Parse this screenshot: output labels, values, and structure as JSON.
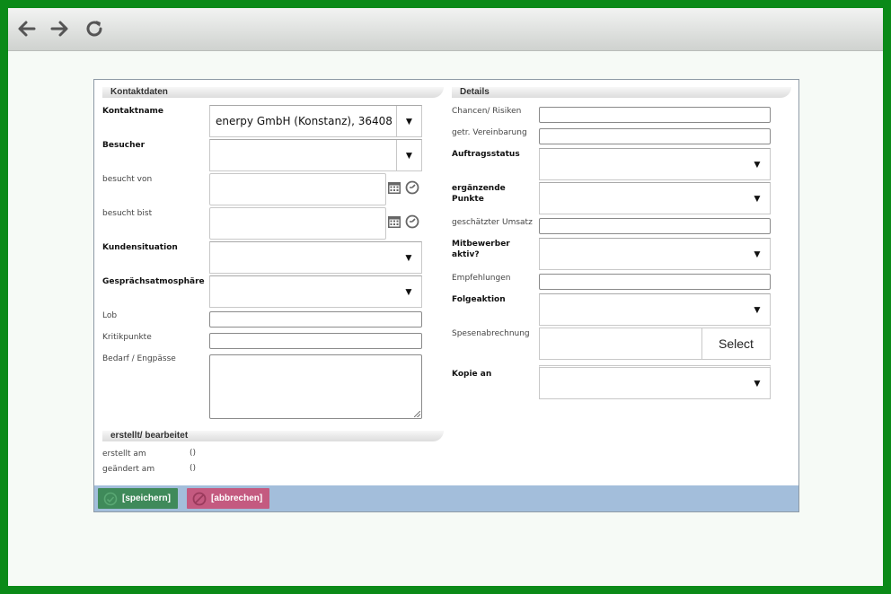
{
  "toolbar": {
    "back_icon": "arrow-left-icon",
    "forward_icon": "arrow-right-icon",
    "reload_icon": "reload-icon"
  },
  "contact": {
    "heading": "Kontaktdaten",
    "kontaktname_label": "Kontaktname",
    "kontaktname_value": "enerpy GmbH (Konstanz), 36408",
    "besucher_label": "Besucher",
    "besucht_von_label": "besucht von",
    "besucht_bist_label": "besucht bist",
    "kundensituation_label": "Kundensituation",
    "gespraech_label": "Gesprächsatmosphäre",
    "lob_label": "Lob",
    "kritik_label": "Kritikpunkte",
    "bedarf_label": "Bedarf / Engpässe"
  },
  "details": {
    "heading": "Details",
    "chancen_label": "Chancen/ Risiken",
    "vereinbarung_label": "getr. Vereinbarung",
    "auftragsstatus_label": "Auftragsstatus",
    "ergaenzende_label": "ergänzende Punkte",
    "umsatz_label": "geschätzter Umsatz",
    "mitbewerber_label": "Mitbewerber aktiv?",
    "empfehlungen_label": "Empfehlungen",
    "folgeaktion_label": "Folgeaktion",
    "spesen_label": "Spesenabrechnung",
    "spesen_button": "Select",
    "kopie_label": "Kopie an"
  },
  "meta": {
    "heading": "erstellt/ bearbeitet",
    "erstellt_label": "erstellt am",
    "erstellt_value": "()",
    "geaendert_label": "geändert am",
    "geaendert_value": "()"
  },
  "footer": {
    "save_label": "[speichern]",
    "cancel_label": "[abbrechen]",
    "save_color": "#3f8a5a",
    "cancel_color": "#c45a80"
  },
  "colors": {
    "frame": "#0b8a18",
    "footer_bar": "#a3bedb"
  }
}
